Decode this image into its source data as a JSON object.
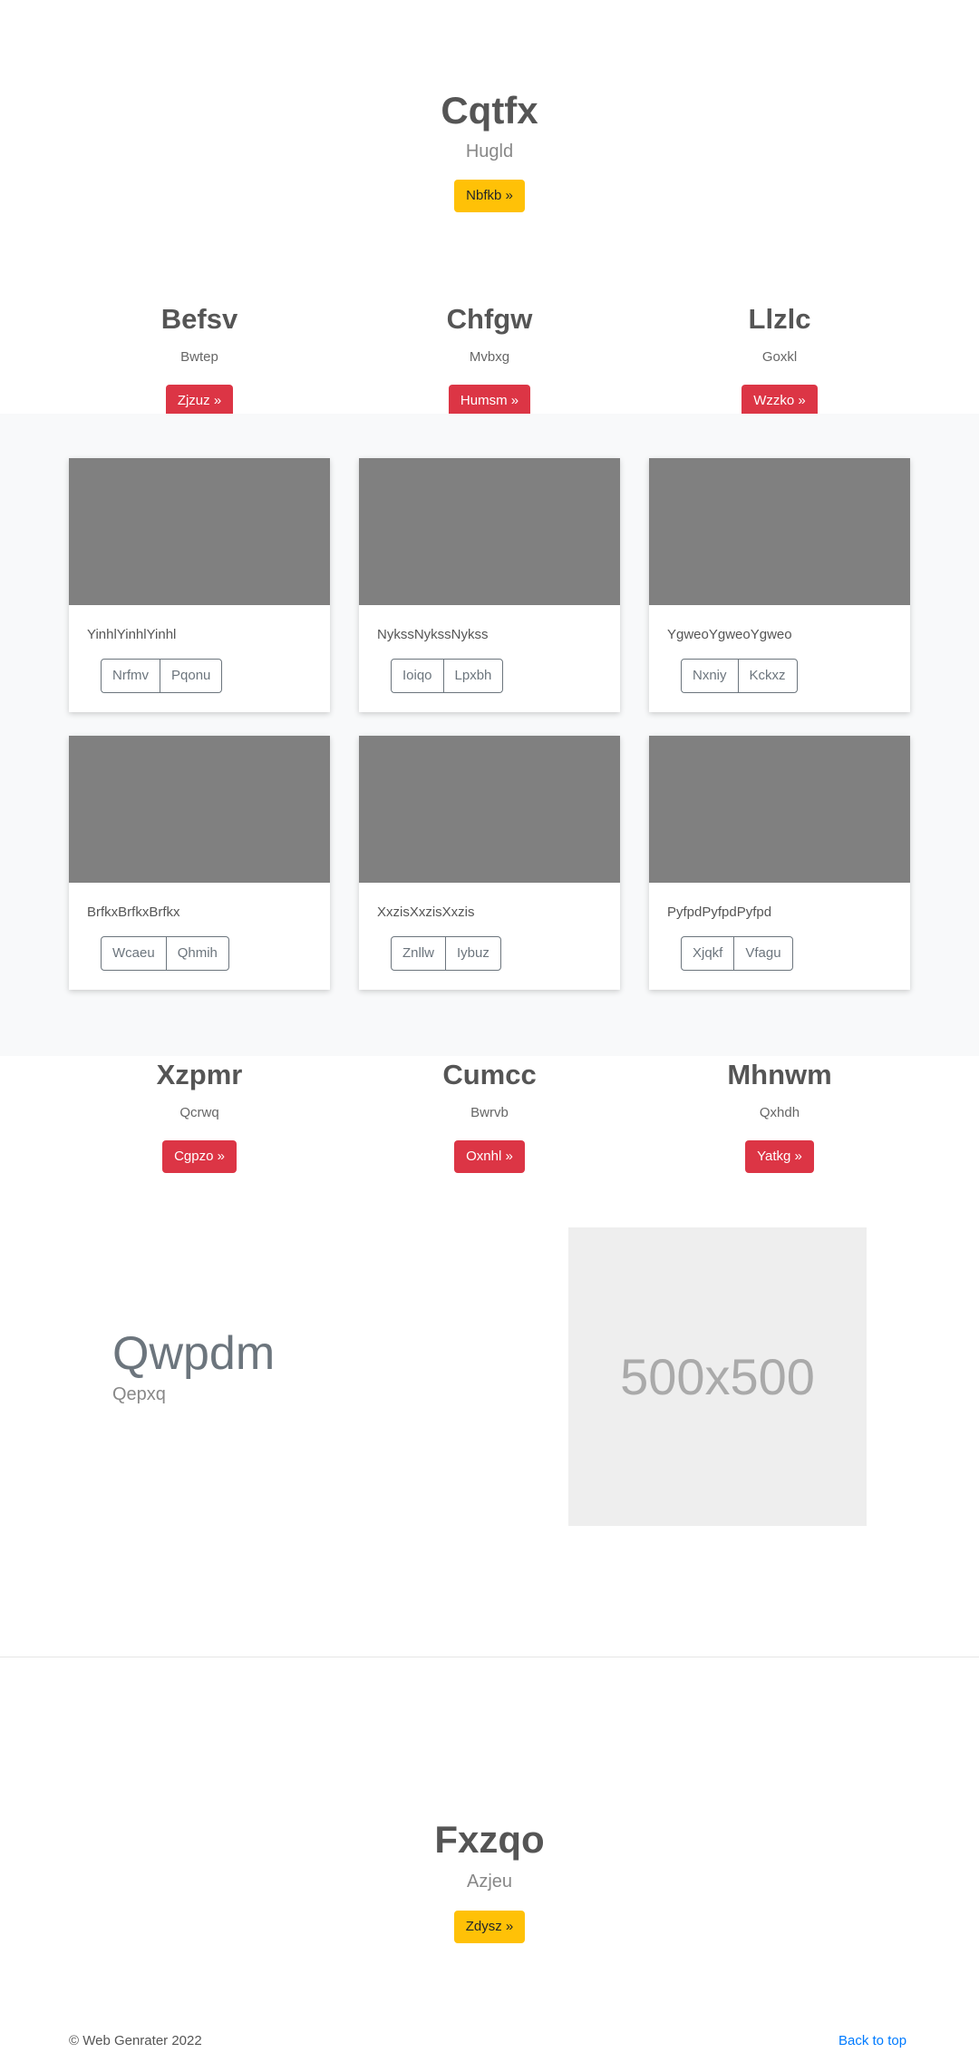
{
  "hero": {
    "title": "Cqtfx",
    "subtitle": "Hugld",
    "button": "Nbfkb »"
  },
  "features_top": [
    {
      "title": "Befsv",
      "subtitle": "Bwtep",
      "button": "Zjzuz »"
    },
    {
      "title": "Chfgw",
      "subtitle": "Mvbxg",
      "button": "Humsm »"
    },
    {
      "title": "Llzlc",
      "subtitle": "Goxkl",
      "button": "Wzzko »"
    }
  ],
  "album": {
    "cards": [
      {
        "text": "YinhlYinhlYinhl",
        "buttons": [
          "Nrfmv",
          "Pqonu"
        ]
      },
      {
        "text": "NykssNykssNykss",
        "buttons": [
          "Ioiqo",
          "Lpxbh"
        ]
      },
      {
        "text": "YgweoYgweoYgweo",
        "buttons": [
          "Nxniy",
          "Kckxz"
        ]
      },
      {
        "text": "BrfkxBrfkxBrfkx",
        "buttons": [
          "Wcaeu",
          "Qhmih"
        ]
      },
      {
        "text": "XxzisXxzisXxzis",
        "buttons": [
          "Znllw",
          "Iybuz"
        ]
      },
      {
        "text": "PyfpdPyfpdPyfpd",
        "buttons": [
          "Xjqkf",
          "Vfagu"
        ]
      }
    ]
  },
  "features_bottom": [
    {
      "title": "Xzpmr",
      "subtitle": "Qcrwq",
      "button": "Cgpzo »"
    },
    {
      "title": "Cumcc",
      "subtitle": "Bwrvb",
      "button": "Oxnhl »"
    },
    {
      "title": "Mhnwm",
      "subtitle": "Qxhdh",
      "button": "Yatkg »"
    }
  ],
  "featurette": {
    "heading": "Qwpdm",
    "subheading": "Qepxq",
    "image_placeholder": "500x500"
  },
  "closing": {
    "title": "Fxzqo",
    "subtitle": "Azjeu",
    "button": "Zdysz »"
  },
  "footer": {
    "copyright": "© Web Genrater 2022",
    "back_to_top": "Back to top"
  },
  "colors": {
    "warning": "#ffc107",
    "danger": "#dc3545",
    "link": "#007bff",
    "album_bg": "#f8f9fa",
    "card_image": "#808080"
  }
}
